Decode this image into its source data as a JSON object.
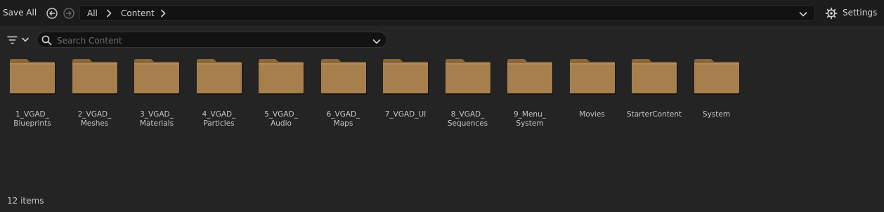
{
  "toolbar": {
    "save_all_label": "Save All",
    "back_icon": "arrow-left-circle-icon",
    "forward_icon": "arrow-right-circle-icon",
    "settings_label": "Settings",
    "settings_icon": "gear-icon"
  },
  "breadcrumb": {
    "items": [
      "All",
      "Content"
    ],
    "separator_icon": "chevron-right-icon",
    "dropdown_icon": "chevron-down-icon"
  },
  "search": {
    "placeholder": "Search Content",
    "value": ""
  },
  "filter": {
    "icon": "filter-icon"
  },
  "folders": [
    {
      "label": "1_VGAD_\nBlueprints"
    },
    {
      "label": "2_VGAD_\nMeshes"
    },
    {
      "label": "3_VGAD_\nMaterials"
    },
    {
      "label": "4_VGAD_\nParticles"
    },
    {
      "label": "5_VGAD_\nAudio"
    },
    {
      "label": "6_VGAD_\nMaps"
    },
    {
      "label": "7_VGAD_UI"
    },
    {
      "label": "8_VGAD_\nSequences"
    },
    {
      "label": "9_Menu_\nSystem"
    },
    {
      "label": "Movies"
    },
    {
      "label": "StarterContent"
    },
    {
      "label": "System"
    }
  ],
  "status": {
    "item_count": "12 items"
  },
  "colors": {
    "folder": "#a77f4d",
    "folder_tab": "#8a6739",
    "background": "#242424",
    "topbar": "#1c1c1c"
  }
}
